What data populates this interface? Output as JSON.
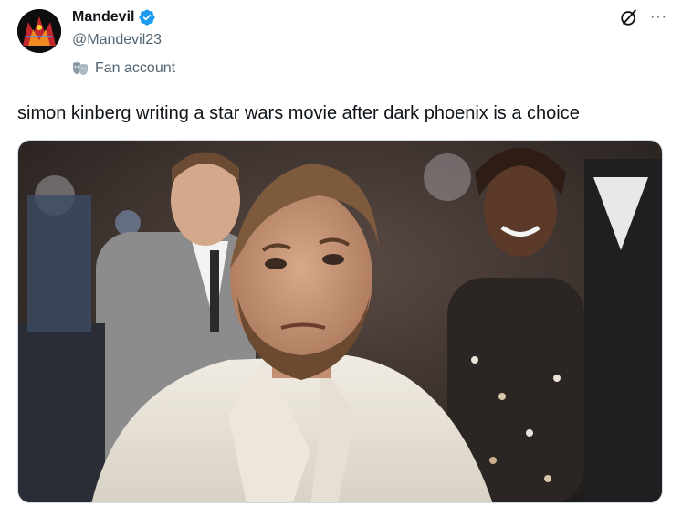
{
  "tweet": {
    "author": {
      "display_name": "Mandevil",
      "handle": "@Mandevil23",
      "verified": true,
      "affiliation": "Fan account"
    },
    "text": "simon kinberg writing a star wars movie after dark phoenix is a choice",
    "more_label": "···"
  },
  "icons": {
    "verified": "verified-badge-icon",
    "grok": "grok-icon",
    "more": "more-icon",
    "affiliation": "masks-icon"
  },
  "colors": {
    "primary_text": "#0f1419",
    "secondary_text": "#536471",
    "verified_blue": "#1d9bf0",
    "border": "#cfd9de"
  }
}
